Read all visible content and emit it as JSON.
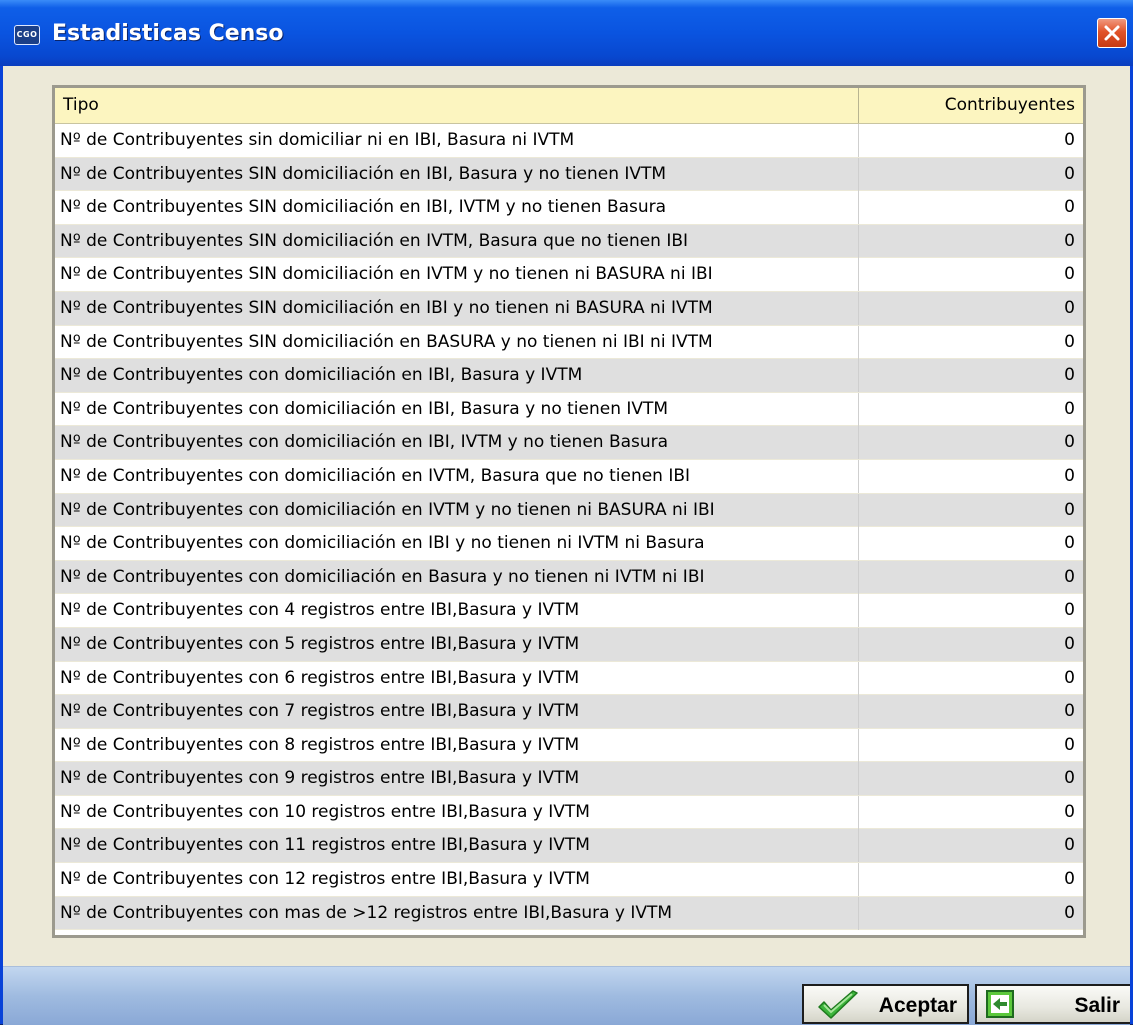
{
  "window": {
    "title": "Estadisticas Censo",
    "icon_text": "CGO",
    "icon": "app-cgo-icon",
    "close_icon": "close-icon"
  },
  "table": {
    "columns": [
      "Tipo",
      "Contribuyentes"
    ],
    "rows": [
      {
        "tipo": "Nº de Contribuyentes sin domiciliar ni en IBI, Basura ni IVTM",
        "contribuyentes": "0"
      },
      {
        "tipo": "Nº de Contribuyentes SIN domiciliación en IBI, Basura y no tienen IVTM",
        "contribuyentes": "0"
      },
      {
        "tipo": "Nº de Contribuyentes SIN domiciliación en IBI, IVTM y no tienen Basura",
        "contribuyentes": "0"
      },
      {
        "tipo": "Nº de Contribuyentes SIN domiciliación en IVTM, Basura que no tienen IBI",
        "contribuyentes": "0"
      },
      {
        "tipo": "Nº de Contribuyentes SIN domiciliación en IVTM y no tienen ni BASURA ni IBI",
        "contribuyentes": "0"
      },
      {
        "tipo": "Nº de Contribuyentes SIN domiciliación en IBI y no tienen ni BASURA ni IVTM",
        "contribuyentes": "0"
      },
      {
        "tipo": "Nº de Contribuyentes SIN domiciliación en BASURA y no tienen ni IBI ni IVTM",
        "contribuyentes": "0"
      },
      {
        "tipo": "Nº de Contribuyentes con domiciliación en IBI, Basura y IVTM",
        "contribuyentes": "0"
      },
      {
        "tipo": "Nº de Contribuyentes con domiciliación en IBI, Basura y no tienen IVTM",
        "contribuyentes": "0"
      },
      {
        "tipo": "Nº de Contribuyentes con domiciliación en IBI, IVTM y no tienen Basura",
        "contribuyentes": "0"
      },
      {
        "tipo": "Nº de Contribuyentes con domiciliación en IVTM, Basura que no tienen IBI",
        "contribuyentes": "0"
      },
      {
        "tipo": "Nº de Contribuyentes con domiciliación en IVTM y no tienen ni BASURA ni IBI",
        "contribuyentes": "0"
      },
      {
        "tipo": "Nº de Contribuyentes con domiciliación en IBI y no tienen ni IVTM ni Basura",
        "contribuyentes": "0"
      },
      {
        "tipo": "Nº de Contribuyentes con domiciliación en Basura y no tienen ni IVTM ni IBI",
        "contribuyentes": "0"
      },
      {
        "tipo": "Nº de Contribuyentes con 4 registros entre IBI,Basura y IVTM",
        "contribuyentes": "0"
      },
      {
        "tipo": "Nº de Contribuyentes con 5 registros entre IBI,Basura y IVTM",
        "contribuyentes": "0"
      },
      {
        "tipo": "Nº de Contribuyentes con 6 registros entre IBI,Basura y IVTM",
        "contribuyentes": "0"
      },
      {
        "tipo": "Nº de Contribuyentes con 7 registros entre IBI,Basura y IVTM",
        "contribuyentes": "0"
      },
      {
        "tipo": "Nº de Contribuyentes con 8 registros entre IBI,Basura y IVTM",
        "contribuyentes": "0"
      },
      {
        "tipo": "Nº de Contribuyentes con 9 registros entre IBI,Basura y IVTM",
        "contribuyentes": "0"
      },
      {
        "tipo": "Nº de Contribuyentes con 10 registros entre IBI,Basura y IVTM",
        "contribuyentes": "0"
      },
      {
        "tipo": "Nº de Contribuyentes con 11 registros entre IBI,Basura y IVTM",
        "contribuyentes": "0"
      },
      {
        "tipo": "Nº de Contribuyentes con 12 registros entre IBI,Basura y IVTM",
        "contribuyentes": "0"
      },
      {
        "tipo": "Nº de Contribuyentes con mas de >12 registros entre IBI,Basura y IVTM",
        "contribuyentes": "0"
      }
    ]
  },
  "buttons": {
    "accept": {
      "label": "Aceptar",
      "icon": "checkmark-icon"
    },
    "exit": {
      "label": "Salir",
      "icon": "exit-arrow-icon"
    }
  },
  "colors": {
    "titlebar": "#0a54e0",
    "header_bg": "#fcf5c0",
    "row_alt": "#dfdfdf",
    "accept_check": "#3cb43c",
    "exit_icon": "#5cc83c"
  }
}
